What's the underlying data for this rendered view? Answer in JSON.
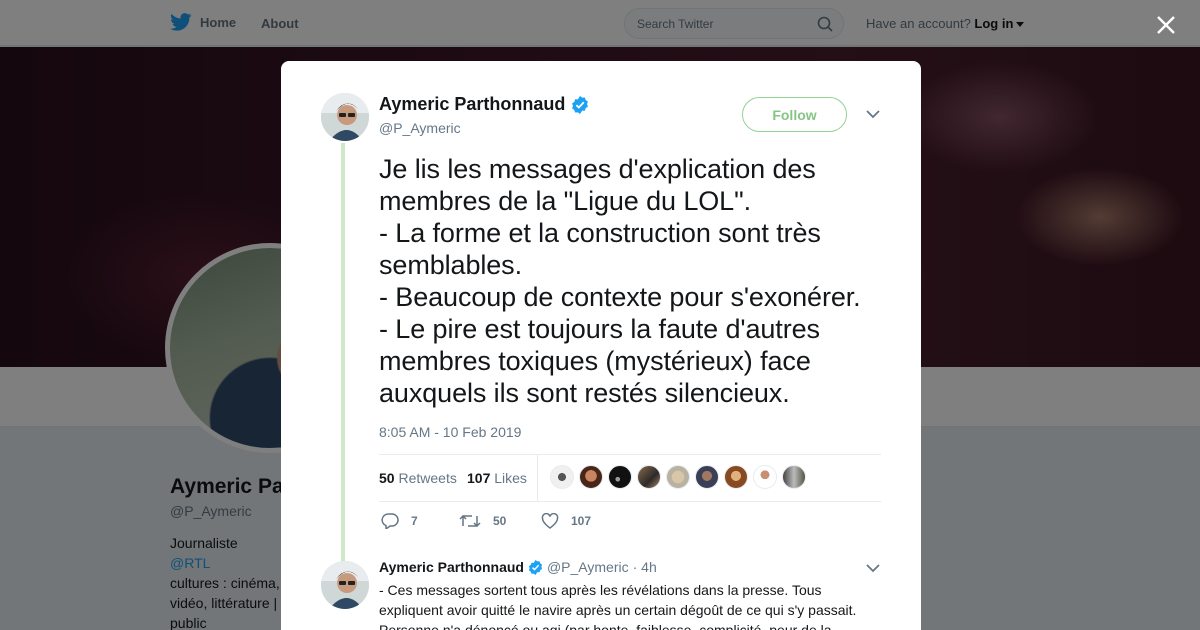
{
  "nav": {
    "home_label": "Home",
    "about_label": "About",
    "search_placeholder": "Search Twitter",
    "account_prompt": "Have an account?",
    "login_label": "Log in"
  },
  "profile": {
    "name": "Aymeric Pa",
    "handle": "@P_Aymeric",
    "bio_line1_pre": "Journaliste ",
    "bio_line1_link": "@RTL",
    "bio_line2": "cultures : cinéma,",
    "bio_line3": "vidéo, littérature |",
    "bio_line4": "public"
  },
  "tweet": {
    "author_name": "Aymeric Parthonnaud",
    "author_handle": "@P_Aymeric",
    "follow_label": "Follow",
    "text": "Je lis les messages d'explication des\nmembres de la \"Ligue du LOL\".\n- La forme et la construction sont très\nsemblables.\n- Beaucoup de contexte pour s'exonérer.\n- Le pire est toujours la faute d'autres\nmembres toxiques (mystérieux) face\nauxquels ils sont restés silencieux.",
    "timestamp": "8:05 AM - 10 Feb 2019",
    "retweets_count": "50",
    "retweets_label": "Retweets",
    "likes_count": "107",
    "likes_label": "Likes",
    "reply_count": "7",
    "retweet_action_count": "50",
    "like_action_count": "107"
  },
  "reply": {
    "author_name": "Aymeric Parthonnaud",
    "author_handle": "@P_Aymeric",
    "time": "· 4h",
    "text": "- Ces messages sortent tous après les révélations dans la presse. Tous expliquent avoir quitté le navire après un certain dégoût de ce qui s'y passait. Personne n'a dénoncé ou agi (par honte, faiblesse, complicité, peur de la"
  },
  "colors": {
    "twitter_blue": "#1da1f2",
    "follow_green": "#86c586",
    "verified_blue": "#1da1f2",
    "thread_line": "#cfe9c8"
  }
}
